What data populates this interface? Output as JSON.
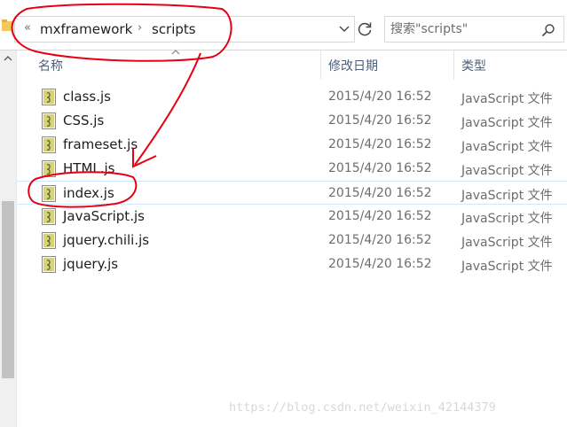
{
  "address": {
    "overflow": "«",
    "crumb1": "mxframework",
    "separator": "›",
    "crumb2": "scripts"
  },
  "search": {
    "placeholder": "搜索\"scripts\""
  },
  "columns": {
    "name": "名称",
    "modified": "修改日期",
    "type": "类型"
  },
  "files": [
    {
      "name": "class.js",
      "modified": "2015/4/20 16:52",
      "type": "JavaScript 文件"
    },
    {
      "name": "CSS.js",
      "modified": "2015/4/20 16:52",
      "type": "JavaScript 文件"
    },
    {
      "name": "frameset.js",
      "modified": "2015/4/20 16:52",
      "type": "JavaScript 文件"
    },
    {
      "name": "HTML.js",
      "modified": "2015/4/20 16:52",
      "type": "JavaScript 文件"
    },
    {
      "name": "index.js",
      "modified": "2015/4/20 16:52",
      "type": "JavaScript 文件"
    },
    {
      "name": "JavaScript.js",
      "modified": "2015/4/20 16:52",
      "type": "JavaScript 文件"
    },
    {
      "name": "jquery.chili.js",
      "modified": "2015/4/20 16:52",
      "type": "JavaScript 文件"
    },
    {
      "name": "jquery.js",
      "modified": "2015/4/20 16:52",
      "type": "JavaScript 文件"
    }
  ],
  "watermark": "https://blog.csdn.net/weixin_42144379",
  "colors": {
    "annotation": "#e60012",
    "selection_border": "#cde8ff",
    "header_text": "#4c607a"
  }
}
